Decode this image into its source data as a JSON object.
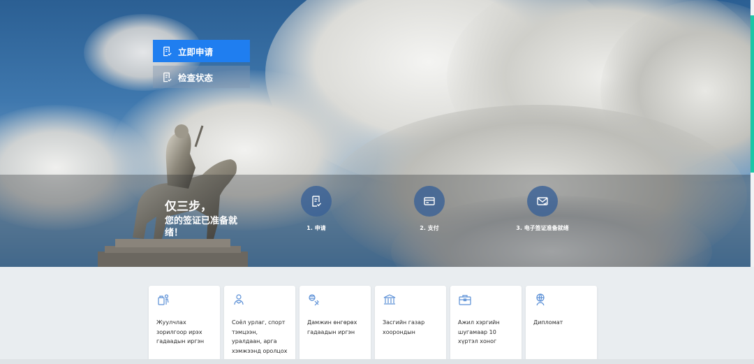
{
  "hero": {
    "buttons": {
      "apply_label": "立即申请",
      "status_label": "检查状态"
    },
    "tagline": {
      "line1": "仅三步，",
      "line2": "您的签证已准备就绪！"
    },
    "steps": [
      {
        "label": "1. 申请",
        "icon": "apply-icon"
      },
      {
        "label": "2. 支付",
        "icon": "card-icon"
      },
      {
        "label": "3. 电子签证准备就绪",
        "icon": "mail-icon"
      }
    ]
  },
  "categories": [
    {
      "label": "Жуулчлах зорилгоор ирэх гадаадын иргэн",
      "icon": "tourist-icon"
    },
    {
      "label": "Соёл урлаг, спорт тэмцээн, уралдаан, арга хэмжээнд оролцох",
      "icon": "culture-sport-icon"
    },
    {
      "label": "Дамжин өнгөрөх гадаадын иргэн",
      "icon": "transit-icon"
    },
    {
      "label": "Засгийн газар хоорондын",
      "icon": "government-icon"
    },
    {
      "label": "Ажил хэргийн шугамаар 10 хүртэл хоног",
      "icon": "business-icon"
    },
    {
      "label": "Дипломат",
      "icon": "diplomat-icon"
    }
  ],
  "colors": {
    "primary": "#1f7ef0",
    "accent": "#1cc7a6",
    "step_circle": "#3a6296",
    "icon_blue": "#5a8fd6"
  }
}
